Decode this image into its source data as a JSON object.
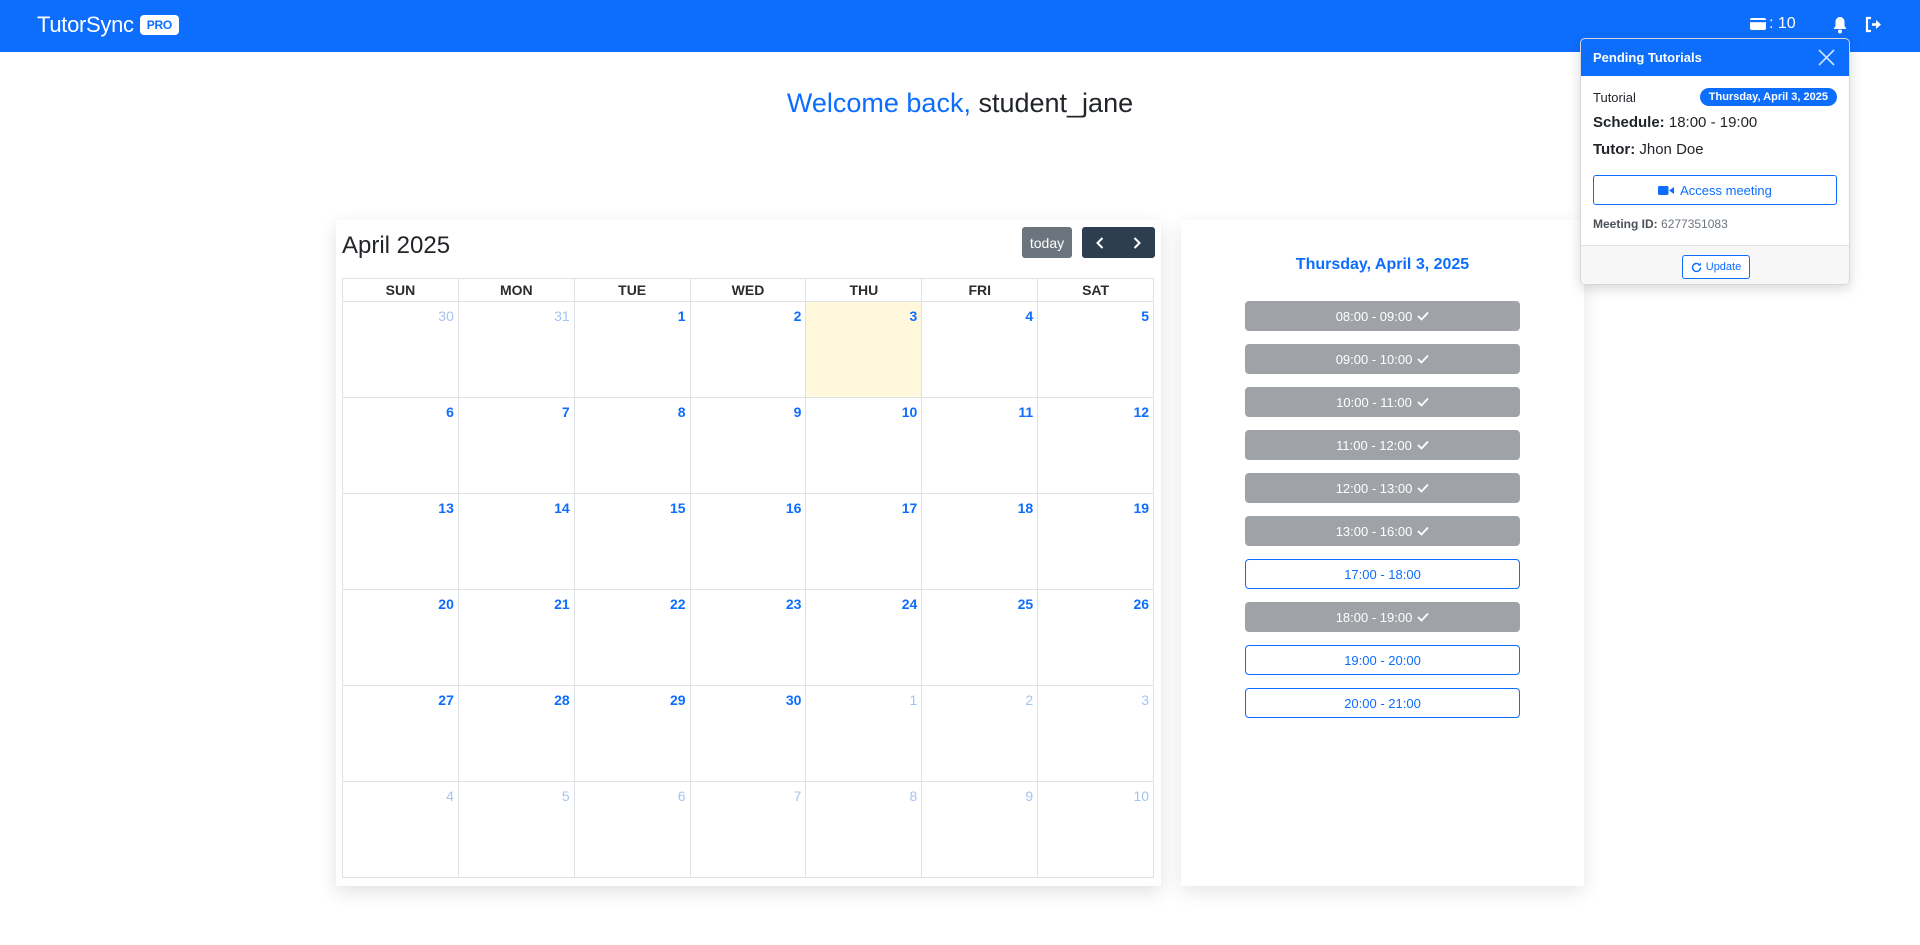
{
  "navbar": {
    "brand": "TutorSync",
    "badge": "PRO",
    "credits_label": ": 10",
    "icons": [
      "wallet-icon",
      "bell-icon",
      "logout-icon"
    ]
  },
  "welcome": {
    "prefix": "Welcome back,",
    "username": "student_jane"
  },
  "calendar": {
    "title": "April 2025",
    "today_label": "today",
    "days": [
      "SUN",
      "MON",
      "TUE",
      "WED",
      "THU",
      "FRI",
      "SAT"
    ],
    "weeks": [
      [
        {
          "d": "30",
          "other": true
        },
        {
          "d": "31",
          "other": true
        },
        {
          "d": "1"
        },
        {
          "d": "2"
        },
        {
          "d": "3",
          "today": true
        },
        {
          "d": "4"
        },
        {
          "d": "5"
        }
      ],
      [
        {
          "d": "6"
        },
        {
          "d": "7"
        },
        {
          "d": "8"
        },
        {
          "d": "9"
        },
        {
          "d": "10"
        },
        {
          "d": "11"
        },
        {
          "d": "12"
        }
      ],
      [
        {
          "d": "13"
        },
        {
          "d": "14"
        },
        {
          "d": "15"
        },
        {
          "d": "16"
        },
        {
          "d": "17"
        },
        {
          "d": "18"
        },
        {
          "d": "19"
        }
      ],
      [
        {
          "d": "20"
        },
        {
          "d": "21"
        },
        {
          "d": "22"
        },
        {
          "d": "23"
        },
        {
          "d": "24"
        },
        {
          "d": "25"
        },
        {
          "d": "26"
        }
      ],
      [
        {
          "d": "27"
        },
        {
          "d": "28"
        },
        {
          "d": "29"
        },
        {
          "d": "30"
        },
        {
          "d": "1",
          "other": true
        },
        {
          "d": "2",
          "other": true
        },
        {
          "d": "3",
          "other": true
        }
      ],
      [
        {
          "d": "4",
          "other": true
        },
        {
          "d": "5",
          "other": true
        },
        {
          "d": "6",
          "other": true
        },
        {
          "d": "7",
          "other": true
        },
        {
          "d": "8",
          "other": true
        },
        {
          "d": "9",
          "other": true
        },
        {
          "d": "10",
          "other": true
        }
      ]
    ]
  },
  "schedule": {
    "date_title": "Thursday, April 3, 2025",
    "slots": [
      {
        "label": "08:00 - 09:00",
        "booked": true
      },
      {
        "label": "09:00 - 10:00",
        "booked": true
      },
      {
        "label": "10:00 - 11:00",
        "booked": true
      },
      {
        "label": "11:00 - 12:00",
        "booked": true
      },
      {
        "label": "12:00 - 13:00",
        "booked": true
      },
      {
        "label": "13:00 - 16:00",
        "booked": true
      },
      {
        "label": "17:00 - 18:00",
        "booked": false
      },
      {
        "label": "18:00 - 19:00",
        "booked": true
      },
      {
        "label": "19:00 - 20:00",
        "booked": false
      },
      {
        "label": "20:00 - 21:00",
        "booked": false
      }
    ]
  },
  "popup": {
    "title": "Pending Tutorials",
    "type": "Tutorial",
    "date_badge": "Thursday, April 3, 2025",
    "schedule_label": "Schedule:",
    "schedule_value": "18:00 - 19:00",
    "tutor_label": "Tutor:",
    "tutor_value": "Jhon Doe",
    "access_label": "Access meeting",
    "meeting_id_label": "Meeting ID:",
    "meeting_id_value": "6277351083",
    "update_label": "Update"
  },
  "colors": {
    "primary": "#0d6efd",
    "booked": "#9fa3a8",
    "today_bg": "#fff8dc",
    "nav_dark": "#2c3e50"
  }
}
